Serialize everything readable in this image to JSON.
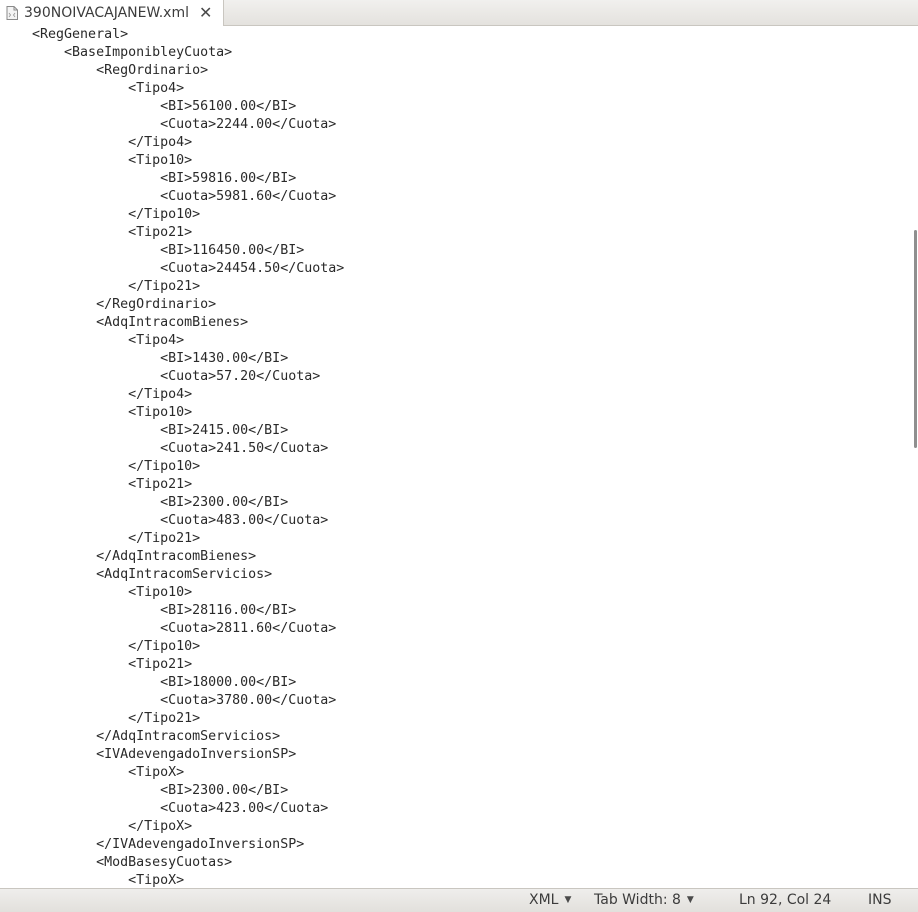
{
  "tab": {
    "filename": "390NOIVACAJANEW.xml",
    "close_glyph": "✕"
  },
  "editor": {
    "lines": [
      "    <RegGeneral>",
      "        <BaseImponibleyCuota>",
      "            <RegOrdinario>",
      "                <Tipo4>",
      "                    <BI>56100.00</BI>",
      "                    <Cuota>2244.00</Cuota>",
      "                </Tipo4>",
      "                <Tipo10>",
      "                    <BI>59816.00</BI>",
      "                    <Cuota>5981.60</Cuota>",
      "                </Tipo10>",
      "                <Tipo21>",
      "                    <BI>116450.00</BI>",
      "                    <Cuota>24454.50</Cuota>",
      "                </Tipo21>",
      "            </RegOrdinario>",
      "            <AdqIntracomBienes>",
      "                <Tipo4>",
      "                    <BI>1430.00</BI>",
      "                    <Cuota>57.20</Cuota>",
      "                </Tipo4>",
      "                <Tipo10>",
      "                    <BI>2415.00</BI>",
      "                    <Cuota>241.50</Cuota>",
      "                </Tipo10>",
      "                <Tipo21>",
      "                    <BI>2300.00</BI>",
      "                    <Cuota>483.00</Cuota>",
      "                </Tipo21>",
      "            </AdqIntracomBienes>",
      "            <AdqIntracomServicios>",
      "                <Tipo10>",
      "                    <BI>28116.00</BI>",
      "                    <Cuota>2811.60</Cuota>",
      "                </Tipo10>",
      "                <Tipo21>",
      "                    <BI>18000.00</BI>",
      "                    <Cuota>3780.00</Cuota>",
      "                </Tipo21>",
      "            </AdqIntracomServicios>",
      "            <IVAdevengadoInversionSP>",
      "                <TipoX>",
      "                    <BI>2300.00</BI>",
      "                    <Cuota>423.00</Cuota>",
      "                </TipoX>",
      "            </IVAdevengadoInversionSP>",
      "            <ModBasesyCuotas>",
      "                <TipoX>"
    ]
  },
  "statusbar": {
    "language": "XML",
    "tab_width": "Tab Width: 8",
    "position": "Ln 92, Col 24",
    "mode": "INS"
  },
  "icons": {
    "file": "file-icon",
    "close": "close-icon",
    "dropdown": "chevron-down-icon"
  }
}
